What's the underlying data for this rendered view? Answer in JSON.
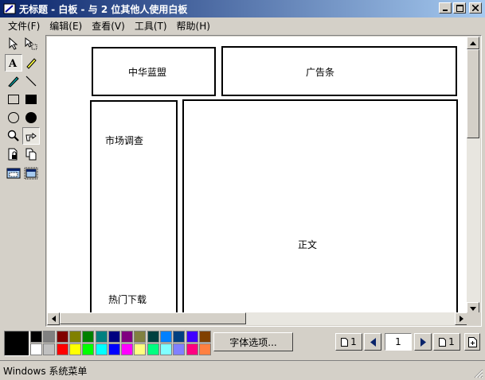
{
  "window": {
    "title": "无标题 - 白板 - 与 2 位其他人使用白板"
  },
  "menu": [
    {
      "label": "文件(F)"
    },
    {
      "label": "编辑(E)"
    },
    {
      "label": "查看(V)"
    },
    {
      "label": "工具(T)"
    },
    {
      "label": "帮助(H)"
    }
  ],
  "tools": [
    "select-arrow",
    "remote-pointer",
    "text",
    "highlighter",
    "pen",
    "line",
    "unfilled-rectangle",
    "filled-rectangle",
    "unfilled-ellipse",
    "filled-ellipse",
    "zoom",
    "remote-pointer-hand",
    "lock-contents",
    "synchronize",
    "select-area",
    "select-window"
  ],
  "canvas": {
    "boxes": [
      {
        "label": "中华蓝盟"
      },
      {
        "label": "广告条"
      },
      {
        "label": "市场调查"
      },
      {
        "label": "热门下载"
      },
      {
        "label": "正文"
      }
    ]
  },
  "palette": {
    "current": "#000000",
    "top_row": [
      "#000000",
      "#808080",
      "#800000",
      "#808000",
      "#008000",
      "#008080",
      "#000080",
      "#800080",
      "#808040",
      "#004040",
      "#0080ff",
      "#004080",
      "#4000ff",
      "#804000"
    ],
    "bottom_row": [
      "#ffffff",
      "#c0c0c0",
      "#ff0000",
      "#ffff00",
      "#00ff00",
      "#00ffff",
      "#0000ff",
      "#ff00ff",
      "#ffff80",
      "#00ff80",
      "#80ffff",
      "#8080ff",
      "#ff0080",
      "#ff8040"
    ]
  },
  "font_button": {
    "label": "字体选项..."
  },
  "pager": {
    "first_page": "1",
    "current_page": "1",
    "last_page": "1"
  },
  "status": {
    "text": "Windows 系统菜单"
  }
}
